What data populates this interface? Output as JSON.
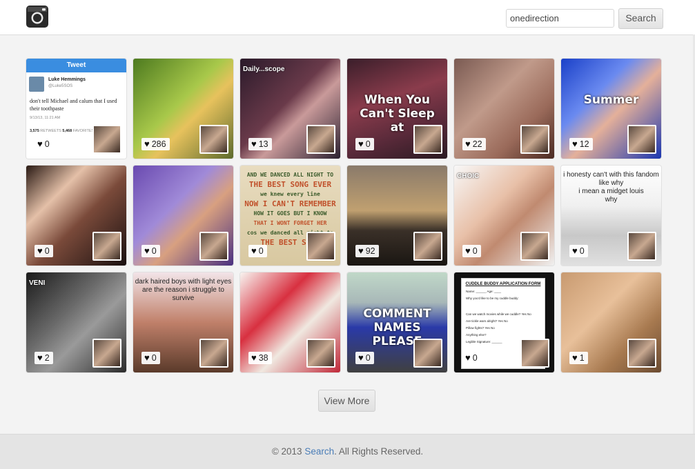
{
  "header": {
    "search_value": "onedirection",
    "search_button": "Search",
    "logo_icon": "camera-icon"
  },
  "tiles": [
    {
      "likes": "0",
      "bg": "tweet",
      "tweet": {
        "title": "Tweet",
        "user": "Luke Hemmings",
        "handle": "@Luke5SOS",
        "text": "don't tell Michael and calum that I used their toothpaste",
        "date": "9/13/13, 11:21 AM",
        "retweets": "3,575",
        "retweets_label": "RETWEETS",
        "favorites": "5,468",
        "favorites_label": "FAVORITES"
      }
    },
    {
      "likes": "286",
      "bg": "linear-gradient(135deg,#4d7a1f,#a8c84a 45%,#e7c25d 60%,#5d6a2c)"
    },
    {
      "likes": "13",
      "bg": "linear-gradient(135deg,#2a1a2a,#6a3a4a 45%,#c99a9a 60%,#2a2030)",
      "overlay": "Daily...scope"
    },
    {
      "likes": "0",
      "bg": "linear-gradient(160deg,#3a1e2a,#8a3c4c 40%,#5a2a3a 70%,#2a1a22)",
      "caption": "When You Can't Sleep at"
    },
    {
      "likes": "22",
      "bg": "linear-gradient(135deg,#7a5a52,#c09a8a 40%,#9a6a5a 70%,#4a2a22)"
    },
    {
      "likes": "12",
      "bg": "linear-gradient(135deg,#1a40c8,#6a8af0 35%,#e4b09a 55%,#1a36b0)",
      "caption": "Summer"
    },
    {
      "likes": "0",
      "bg": "linear-gradient(135deg,#2a1a14,#e4c0a8 30%,#7a4a3a 55%,#1a1010)"
    },
    {
      "likes": "0",
      "bg": "linear-gradient(135deg,#6a4ab0,#a08ad8 40%,#d8a080 60%,#4a3080)"
    },
    {
      "likes": "0",
      "bg": "linear-gradient(#e8dcc0,#d8c8a0)",
      "quote": [
        "AND WE DANCED ALL NIGHT TO",
        "THE BEST SONG EVER",
        "we knew every line",
        "NOW I CAN'T REMEMBER",
        "HOW IT GOES BUT I KNOW",
        "THAT I WONT FORGET HER",
        "cos we danced all night to",
        "THE BEST SONG"
      ]
    },
    {
      "likes": "92",
      "bg": "linear-gradient(#8a7a6a,#c0a070 45%,#3a3028 65%,#1a1612)"
    },
    {
      "likes": "0",
      "bg": "linear-gradient(135deg,#f8f8f8,#e8c0a8 40%,#c08a70 60%,#f0f0f0)",
      "overlay": "CHOIC"
    },
    {
      "likes": "0",
      "bg": "linear-gradient(#ffffff,#f0f0f0 40%,#c8c8c8 70%,#e0e0e0)",
      "lines": [
        "i honesty can't with this fandom",
        "like why",
        "i mean a midget louis",
        "why"
      ]
    },
    {
      "likes": "2",
      "bg": "linear-gradient(135deg,#1a1a1a,#6a6a6a 40%,#9a9a9a 60%,#2a2a2a)",
      "overlay": "VENI"
    },
    {
      "likes": "0",
      "bg": "linear-gradient(#f2e4e8,#c0806a 50%,#5a3a2a)",
      "lines": [
        "dark haired boys with light eyes",
        "are the reason i struggle to survive"
      ]
    },
    {
      "likes": "38",
      "bg": "linear-gradient(135deg,#f8f4f0,#d83040 35%,#f0e8e0 60%,#c02838)"
    },
    {
      "likes": "0",
      "bg": "linear-gradient(#c0d8c8,#a8b8b8 30%,#2a3aa8 55%,#404040)",
      "caption": "COMMENT NAMES PLEASE"
    },
    {
      "likes": "0",
      "bg": "linear-gradient(#111,#111)",
      "form": {
        "title": "CUDDLE BUDDY APPLICATION FORM",
        "rows": [
          "Name: ______ Age: ____",
          "Why you'd like to be my cuddle buddy:",
          "Can we watch movies while we cuddle? Yes No",
          "Are tickle wars alright? Yes No",
          "Pillow fights? Yes No",
          "Anything else?",
          "Legible Signature: ______"
        ]
      }
    },
    {
      "likes": "1",
      "bg": "linear-gradient(135deg,#c89a70,#e8c09a 40%,#a87a50 70%,#6a4a30)"
    }
  ],
  "view_more": "View More",
  "footer": {
    "prefix": "© 2013 ",
    "link": "Search",
    "suffix": ". All Rights Reserved."
  }
}
